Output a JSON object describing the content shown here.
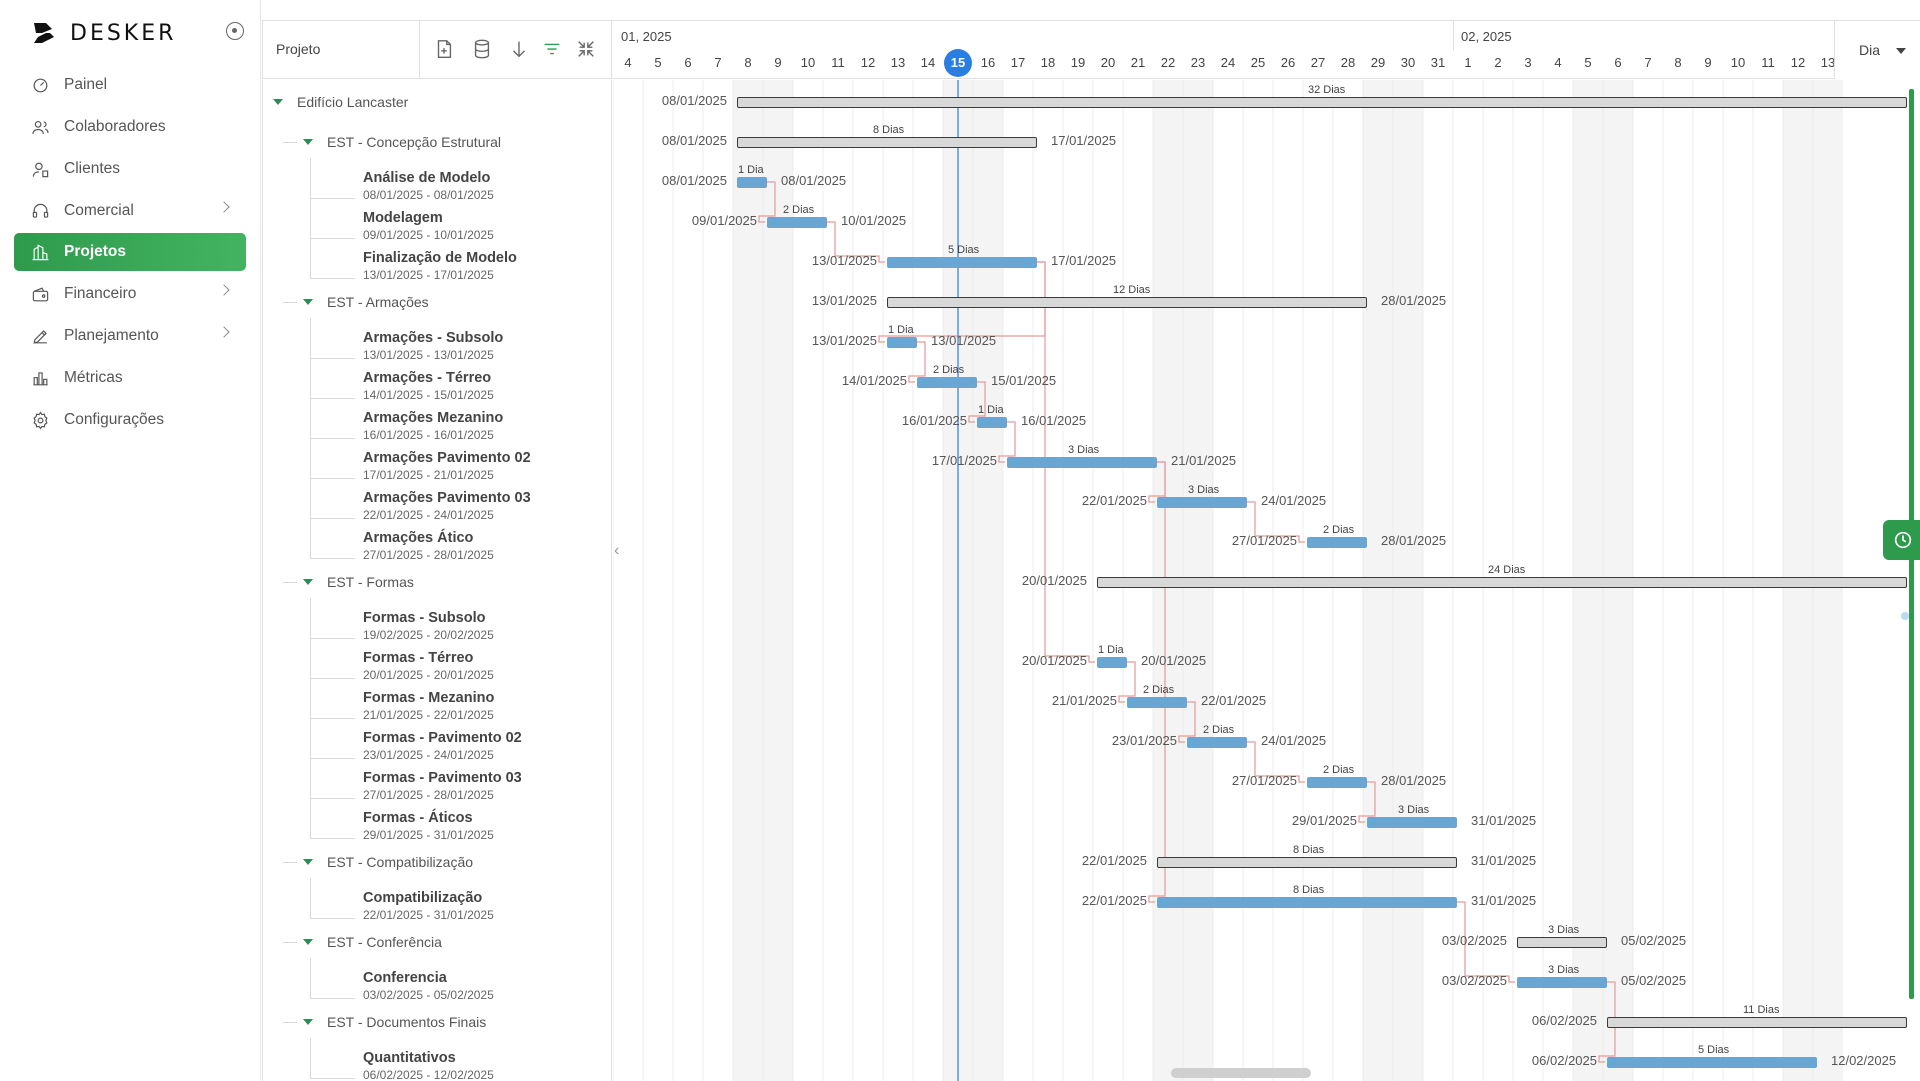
{
  "brand": {
    "name": "DESKER"
  },
  "nav": [
    {
      "label": "Painel",
      "icon": "dashboard-icon",
      "chevron": false,
      "active": false
    },
    {
      "label": "Colaboradores",
      "icon": "users-icon",
      "chevron": false,
      "active": false
    },
    {
      "label": "Clientes",
      "icon": "client-icon",
      "chevron": false,
      "active": false
    },
    {
      "label": "Comercial",
      "icon": "headset-icon",
      "chevron": true,
      "active": false
    },
    {
      "label": "Projetos",
      "icon": "building-icon",
      "chevron": false,
      "active": true
    },
    {
      "label": "Financeiro",
      "icon": "wallet-icon",
      "chevron": true,
      "active": false
    },
    {
      "label": "Planejamento",
      "icon": "pencil-icon",
      "chevron": true,
      "active": false
    },
    {
      "label": "Métricas",
      "icon": "bar-chart-icon",
      "chevron": false,
      "active": false
    },
    {
      "label": "Configurações",
      "icon": "gear-icon",
      "chevron": false,
      "active": false
    }
  ],
  "grid": {
    "column_title": "Projeto",
    "toolbar": [
      "new-task-icon",
      "database-icon",
      "arrow-down-icon",
      "filter-icon",
      "collapse-all-icon"
    ]
  },
  "timeline": {
    "months": [
      "01, 2025",
      "02, 2025"
    ],
    "days": [
      4,
      5,
      6,
      7,
      8,
      9,
      10,
      11,
      12,
      13,
      14,
      15,
      16,
      17,
      18,
      19,
      20,
      21,
      22,
      23,
      24,
      25,
      26,
      27,
      28,
      29,
      30,
      31,
      1,
      2,
      3,
      4,
      5,
      6,
      7,
      8,
      9,
      10,
      11,
      12,
      13
    ],
    "today": 15,
    "zoom": "Dia",
    "colors": {
      "task_bar": "#6aa6d3",
      "group_bar": "#d8d8d8",
      "today_line": "#2a7de1",
      "accent": "#2e9b4c",
      "link": "#e39a9a"
    }
  },
  "rows": [
    {
      "kind": "root",
      "name": "Edifício Lancaster",
      "start": "08/01/2025",
      "end": "",
      "duration": "32 Dias",
      "s": 4,
      "e": 43
    },
    {
      "kind": "group",
      "name": "EST - Concepção Estrutural",
      "start": "08/01/2025",
      "end": "17/01/2025",
      "duration": "8 Dias",
      "s": 4,
      "e": 14
    },
    {
      "kind": "task",
      "name": "Análise de Modelo",
      "dates": "08/01/2025 - 08/01/2025",
      "start": "08/01/2025",
      "end": "08/01/2025",
      "duration": "1 Dia",
      "s": 4,
      "e": 5
    },
    {
      "kind": "task",
      "name": "Modelagem",
      "dates": "09/01/2025 - 10/01/2025",
      "start": "09/01/2025",
      "end": "10/01/2025",
      "duration": "2 Dias",
      "s": 5,
      "e": 7
    },
    {
      "kind": "task",
      "name": "Finalização de Modelo",
      "dates": "13/01/2025 - 17/01/2025",
      "start": "13/01/2025",
      "end": "17/01/2025",
      "duration": "5 Dias",
      "s": 9,
      "e": 14
    },
    {
      "kind": "group",
      "name": "EST - Armações",
      "start": "13/01/2025",
      "end": "28/01/2025",
      "duration": "12 Dias",
      "s": 9,
      "e": 25
    },
    {
      "kind": "task",
      "name": "Armações - Subsolo",
      "dates": "13/01/2025 - 13/01/2025",
      "start": "13/01/2025",
      "end": "13/01/2025",
      "duration": "1 Dia",
      "s": 9,
      "e": 10
    },
    {
      "kind": "task",
      "name": "Armações - Térreo",
      "dates": "14/01/2025 - 15/01/2025",
      "start": "14/01/2025",
      "end": "15/01/2025",
      "duration": "2 Dias",
      "s": 10,
      "e": 12
    },
    {
      "kind": "task",
      "name": "Armações Mezanino",
      "dates": "16/01/2025 - 16/01/2025",
      "start": "16/01/2025",
      "end": "16/01/2025",
      "duration": "1 Dia",
      "s": 12,
      "e": 13
    },
    {
      "kind": "task",
      "name": "Armações Pavimento 02",
      "dates": "17/01/2025 - 21/01/2025",
      "start": "17/01/2025",
      "end": "21/01/2025",
      "duration": "3 Dias",
      "s": 13,
      "e": 18
    },
    {
      "kind": "task",
      "name": "Armações Pavimento 03",
      "dates": "22/01/2025 - 24/01/2025",
      "start": "22/01/2025",
      "end": "24/01/2025",
      "duration": "3 Dias",
      "s": 18,
      "e": 21
    },
    {
      "kind": "task",
      "name": "Armações Ático",
      "dates": "27/01/2025 - 28/01/2025",
      "start": "27/01/2025",
      "end": "28/01/2025",
      "duration": "2 Dias",
      "s": 23,
      "e": 25
    },
    {
      "kind": "group",
      "name": "EST - Formas",
      "start": "20/01/2025",
      "end": "",
      "duration": "24 Dias",
      "s": 16,
      "e": 43
    },
    {
      "kind": "task",
      "name": "Formas - Subsolo",
      "dates": "19/02/2025 - 20/02/2025",
      "start": "",
      "end": "",
      "duration": "",
      "s": null,
      "e": null
    },
    {
      "kind": "task",
      "name": "Formas - Térreo",
      "dates": "20/01/2025 - 20/01/2025",
      "start": "20/01/2025",
      "end": "20/01/2025",
      "duration": "1 Dia",
      "s": 16,
      "e": 17
    },
    {
      "kind": "task",
      "name": "Formas - Mezanino",
      "dates": "21/01/2025 - 22/01/2025",
      "start": "21/01/2025",
      "end": "22/01/2025",
      "duration": "2 Dias",
      "s": 17,
      "e": 19
    },
    {
      "kind": "task",
      "name": "Formas - Pavimento 02",
      "dates": "23/01/2025 - 24/01/2025",
      "start": "23/01/2025",
      "end": "24/01/2025",
      "duration": "2 Dias",
      "s": 19,
      "e": 21
    },
    {
      "kind": "task",
      "name": "Formas - Pavimento 03",
      "dates": "27/01/2025 - 28/01/2025",
      "start": "27/01/2025",
      "end": "28/01/2025",
      "duration": "2 Dias",
      "s": 23,
      "e": 25
    },
    {
      "kind": "task",
      "name": "Formas - Áticos",
      "dates": "29/01/2025 - 31/01/2025",
      "start": "29/01/2025",
      "end": "31/01/2025",
      "duration": "3 Dias",
      "s": 25,
      "e": 28
    },
    {
      "kind": "group",
      "name": "EST - Compatibilização",
      "start": "22/01/2025",
      "end": "31/01/2025",
      "duration": "8 Dias",
      "s": 18,
      "e": 28
    },
    {
      "kind": "task",
      "name": "Compatibilização",
      "dates": "22/01/2025 - 31/01/2025",
      "start": "22/01/2025",
      "end": "31/01/2025",
      "duration": "8 Dias",
      "s": 18,
      "e": 28
    },
    {
      "kind": "group",
      "name": "EST - Conferência",
      "start": "03/02/2025",
      "end": "05/02/2025",
      "duration": "3 Dias",
      "s": 30,
      "e": 33
    },
    {
      "kind": "task",
      "name": "Conferencia",
      "dates": "03/02/2025 - 05/02/2025",
      "start": "03/02/2025",
      "end": "05/02/2025",
      "duration": "3 Dias",
      "s": 30,
      "e": 33
    },
    {
      "kind": "group",
      "name": "EST - Documentos Finais",
      "start": "06/02/2025",
      "end": "",
      "duration": "11 Dias",
      "s": 33,
      "e": 43
    },
    {
      "kind": "task",
      "name": "Quantitativos",
      "dates": "06/02/2025 - 12/02/2025",
      "start": "06/02/2025",
      "end": "12/02/2025",
      "duration": "5 Dias",
      "s": 33,
      "e": 40
    }
  ]
}
